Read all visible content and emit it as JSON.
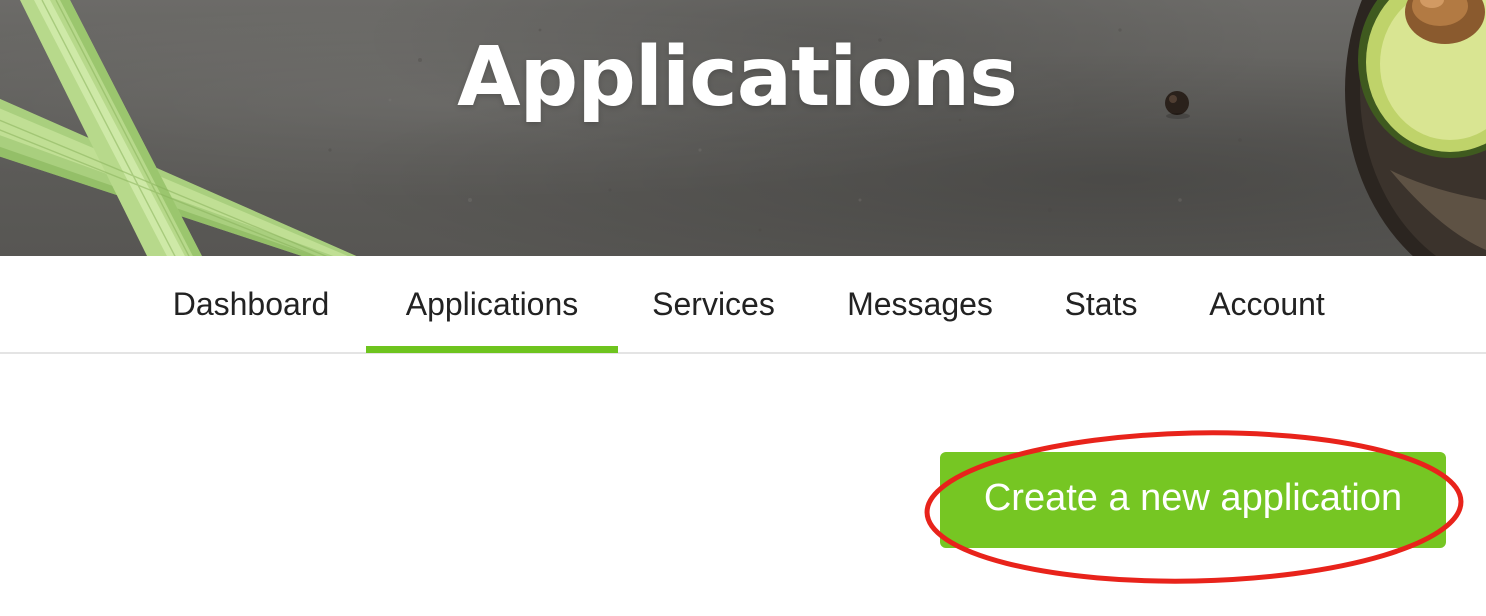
{
  "hero": {
    "title": "Applications"
  },
  "nav": {
    "tabs": [
      {
        "label": "Dashboard",
        "active": false
      },
      {
        "label": "Applications",
        "active": true
      },
      {
        "label": "Services",
        "active": false
      },
      {
        "label": "Messages",
        "active": false
      },
      {
        "label": "Stats",
        "active": false
      },
      {
        "label": "Account",
        "active": false
      }
    ]
  },
  "actions": {
    "create_label": "Create a new application"
  },
  "colors": {
    "accent": "#6ec41e",
    "button": "#76c623",
    "annotation": "#e8231b",
    "hero_bg": "#5f5e5b"
  }
}
